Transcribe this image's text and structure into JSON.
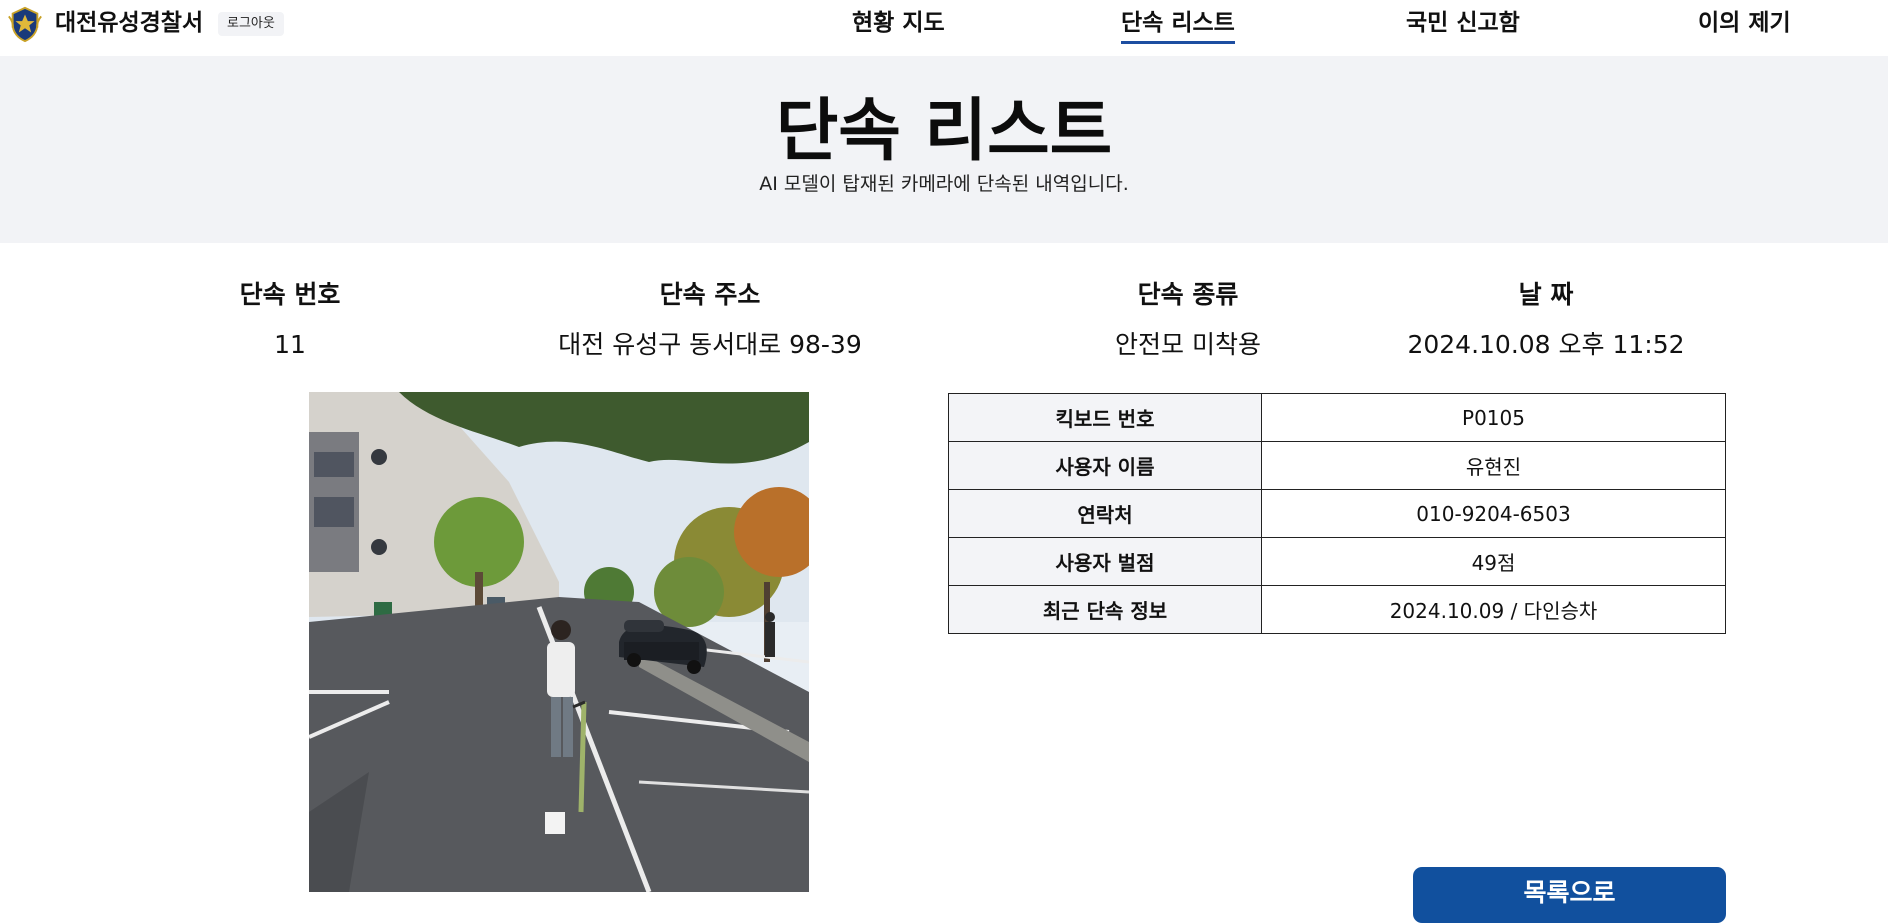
{
  "header": {
    "brand": "대전유성경찰서",
    "logout_label": "로그아웃",
    "nav": [
      {
        "label": "현황 지도"
      },
      {
        "label": "단속 리스트"
      },
      {
        "label": "국민 신고함"
      },
      {
        "label": "이의 제기"
      }
    ]
  },
  "hero": {
    "title": "단속 리스트",
    "subtitle": "AI 모델이 탑재된 카메라에 단속된 내역입니다."
  },
  "summary": {
    "columns": [
      "단속 번호",
      "단속 주소",
      "단속 종류",
      "날 짜"
    ],
    "values": [
      "11",
      "대전 유성구 동서대로 98-39",
      "안전모 미착용",
      "2024.10.08 오후 11:52"
    ]
  },
  "details": {
    "rows": [
      {
        "label": "킥보드 번호",
        "value": "P0105"
      },
      {
        "label": "사용자 이름",
        "value": "유현진"
      },
      {
        "label": "연락처",
        "value": "010-9204-6503"
      },
      {
        "label": "사용자 벌점",
        "value": "49점"
      },
      {
        "label": "최근 단속 정보",
        "value": "2024.10.09 / 다인승차"
      }
    ]
  },
  "back_button": "목록으로",
  "colors": {
    "accent": "#1d4ea1",
    "button": "#11509e",
    "hero_bg": "#f2f3f6"
  },
  "icons": {
    "logo": "police-emblem-icon"
  }
}
